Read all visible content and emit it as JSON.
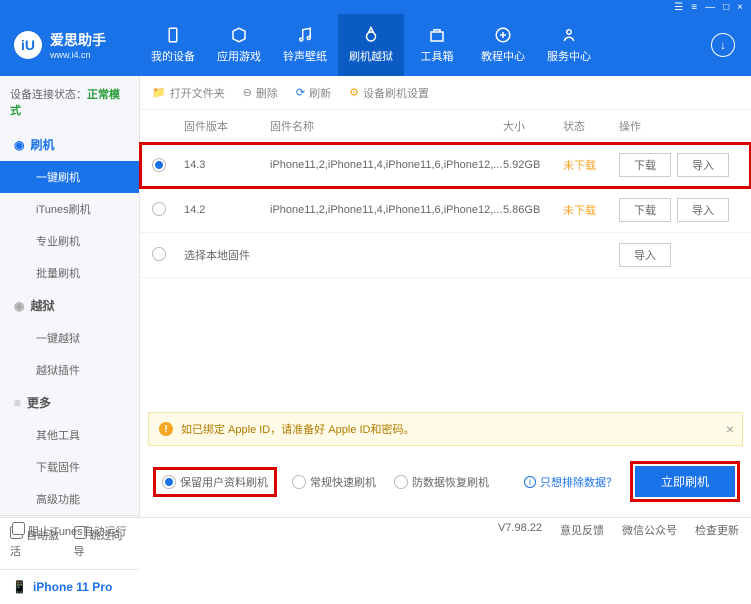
{
  "titlebar": {
    "menu": "☰",
    "grid": "≡",
    "min": "—",
    "max": "□",
    "close": "×"
  },
  "logo": {
    "mark": "iU",
    "name": "爱思助手",
    "url": "www.i4.cn"
  },
  "nav": [
    {
      "label": "我的设备"
    },
    {
      "label": "应用游戏"
    },
    {
      "label": "铃声壁纸"
    },
    {
      "label": "刷机越狱",
      "active": true
    },
    {
      "label": "工具箱"
    },
    {
      "label": "教程中心"
    },
    {
      "label": "服务中心"
    }
  ],
  "status": {
    "label": "设备连接状态：",
    "mode": "正常模式"
  },
  "sidebar": {
    "groups": [
      {
        "title": "刷机",
        "active": true,
        "items": [
          {
            "label": "一键刷机",
            "active": true
          },
          {
            "label": "iTunes刷机"
          },
          {
            "label": "专业刷机"
          },
          {
            "label": "批量刷机"
          }
        ]
      },
      {
        "title": "越狱",
        "items": [
          {
            "label": "一键越狱"
          },
          {
            "label": "越狱插件"
          }
        ]
      },
      {
        "title": "更多",
        "items": [
          {
            "label": "其他工具"
          },
          {
            "label": "下载固件"
          },
          {
            "label": "高级功能"
          }
        ]
      }
    ],
    "checks": {
      "autoActivate": "自动激活",
      "skipGuide": "跳过向导"
    },
    "device": "iPhone 11 Pro"
  },
  "toolbar": {
    "open": "打开文件夹",
    "delete": "删除",
    "refresh": "刷新",
    "settings": "设备刷机设置"
  },
  "table": {
    "headers": {
      "version": "固件版本",
      "name": "固件名称",
      "size": "大小",
      "status": "状态",
      "ops": "操作"
    },
    "rows": [
      {
        "version": "14.3",
        "name": "iPhone11,2,iPhone11,4,iPhone11,6,iPhone12,...",
        "size": "5.92GB",
        "status": "未下载",
        "selected": true,
        "highlight": true,
        "download": "下载",
        "import": "导入"
      },
      {
        "version": "14.2",
        "name": "iPhone11,2,iPhone11,4,iPhone11,6,iPhone12,...",
        "size": "5.86GB",
        "status": "未下载",
        "selected": false,
        "download": "下载",
        "import": "导入"
      },
      {
        "version": "选择本地固件",
        "name": "",
        "size": "",
        "status": "",
        "local": true,
        "import": "导入"
      }
    ]
  },
  "notice": {
    "text": "如已绑定 Apple ID，请准备好 Apple ID和密码。"
  },
  "options": {
    "keepData": "保留用户资料刷机",
    "normal": "常规快速刷机",
    "recovery": "防数据恢复刷机",
    "excludeLink": "只想排除数据？",
    "flashNow": "立即刷机"
  },
  "footer": {
    "blockItunes": "阻止iTunes自动运行",
    "version": "V7.98.22",
    "feedback": "意见反馈",
    "wechat": "微信公众号",
    "update": "检查更新"
  }
}
